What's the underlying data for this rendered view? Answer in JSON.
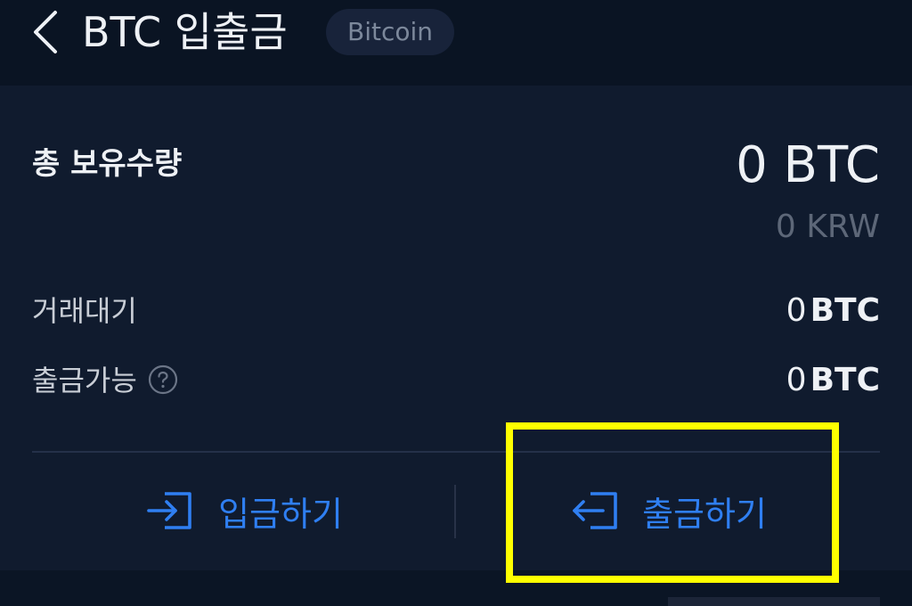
{
  "header": {
    "title": "BTC 입출금",
    "coin_name": "Bitcoin"
  },
  "summary": {
    "total_label": "총 보유수량",
    "total_value": "0 BTC",
    "total_krw": "0 KRW"
  },
  "rows": [
    {
      "label": "거래대기",
      "num": "0",
      "unit": "BTC"
    },
    {
      "label": "출금가능",
      "num": "0",
      "unit": "BTC",
      "help_icon": "question-circle-icon"
    }
  ],
  "actions": {
    "deposit_label": "입금하기",
    "withdraw_label": "출금하기"
  },
  "colors": {
    "accent": "#2f7ff2",
    "background": "#0b1525",
    "card": "#101b2e",
    "highlight": "#ffff00"
  },
  "icons": {
    "back": "chevron-left-icon",
    "deposit": "login-arrow-icon",
    "withdraw": "logout-arrow-icon"
  }
}
